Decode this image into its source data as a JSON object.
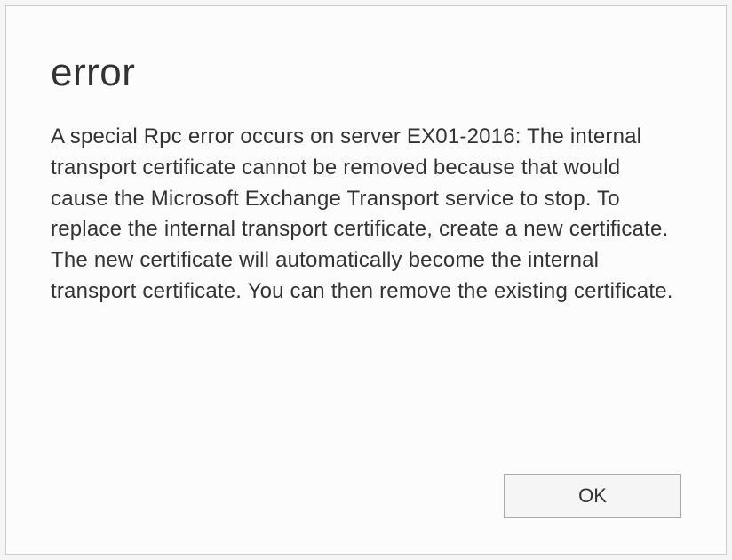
{
  "dialog": {
    "title": "error",
    "message": "A special Rpc error occurs on server EX01-2016: The internal transport certificate cannot be removed because that would cause the Microsoft Exchange Transport service to stop. To replace the internal transport certificate, create a new certificate. The new certificate will automatically become the internal transport certificate. You can then remove the existing certificate.",
    "ok_label": "OK"
  }
}
